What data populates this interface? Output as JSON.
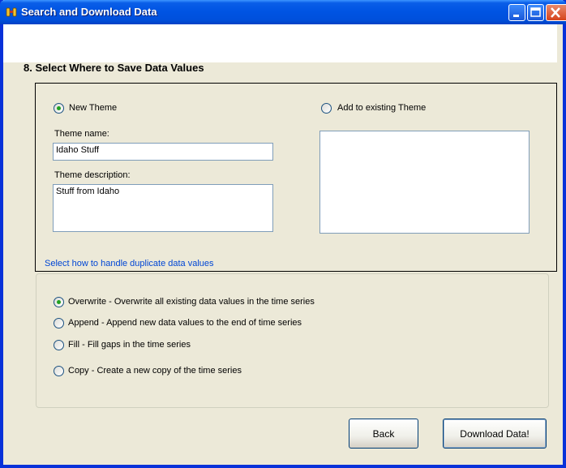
{
  "window": {
    "title": "Search and Download Data",
    "icon": "binoculars-icon"
  },
  "step": {
    "title": "8. Select Where to Save Data Values"
  },
  "theme": {
    "new_theme_label": "New Theme",
    "new_theme_selected": true,
    "existing_theme_label": "Add to existing Theme",
    "existing_theme_selected": false,
    "name_label": "Theme name:",
    "name_value": "Idaho Stuff",
    "description_label": "Theme description:",
    "description_value": "Stuff from Idaho",
    "existing_list_items": []
  },
  "duplicates": {
    "group_label": "Select how to handle duplicate data values",
    "options": [
      {
        "label": "Overwrite - Overwrite all existing data values in the time series",
        "selected": true
      },
      {
        "label": "Append -  Append new data values to the end of time series",
        "selected": false
      },
      {
        "label": "Fill - Fill gaps in the time series",
        "selected": false
      },
      {
        "label": "Copy - Create a new copy of the time series",
        "selected": false
      }
    ]
  },
  "buttons": {
    "back": "Back",
    "download": "Download Data!"
  },
  "colors": {
    "titlebar": "#0054e3",
    "window_bg": "#ece9d8",
    "group_label": "#0046d5",
    "radio_dot": "#21a121"
  }
}
